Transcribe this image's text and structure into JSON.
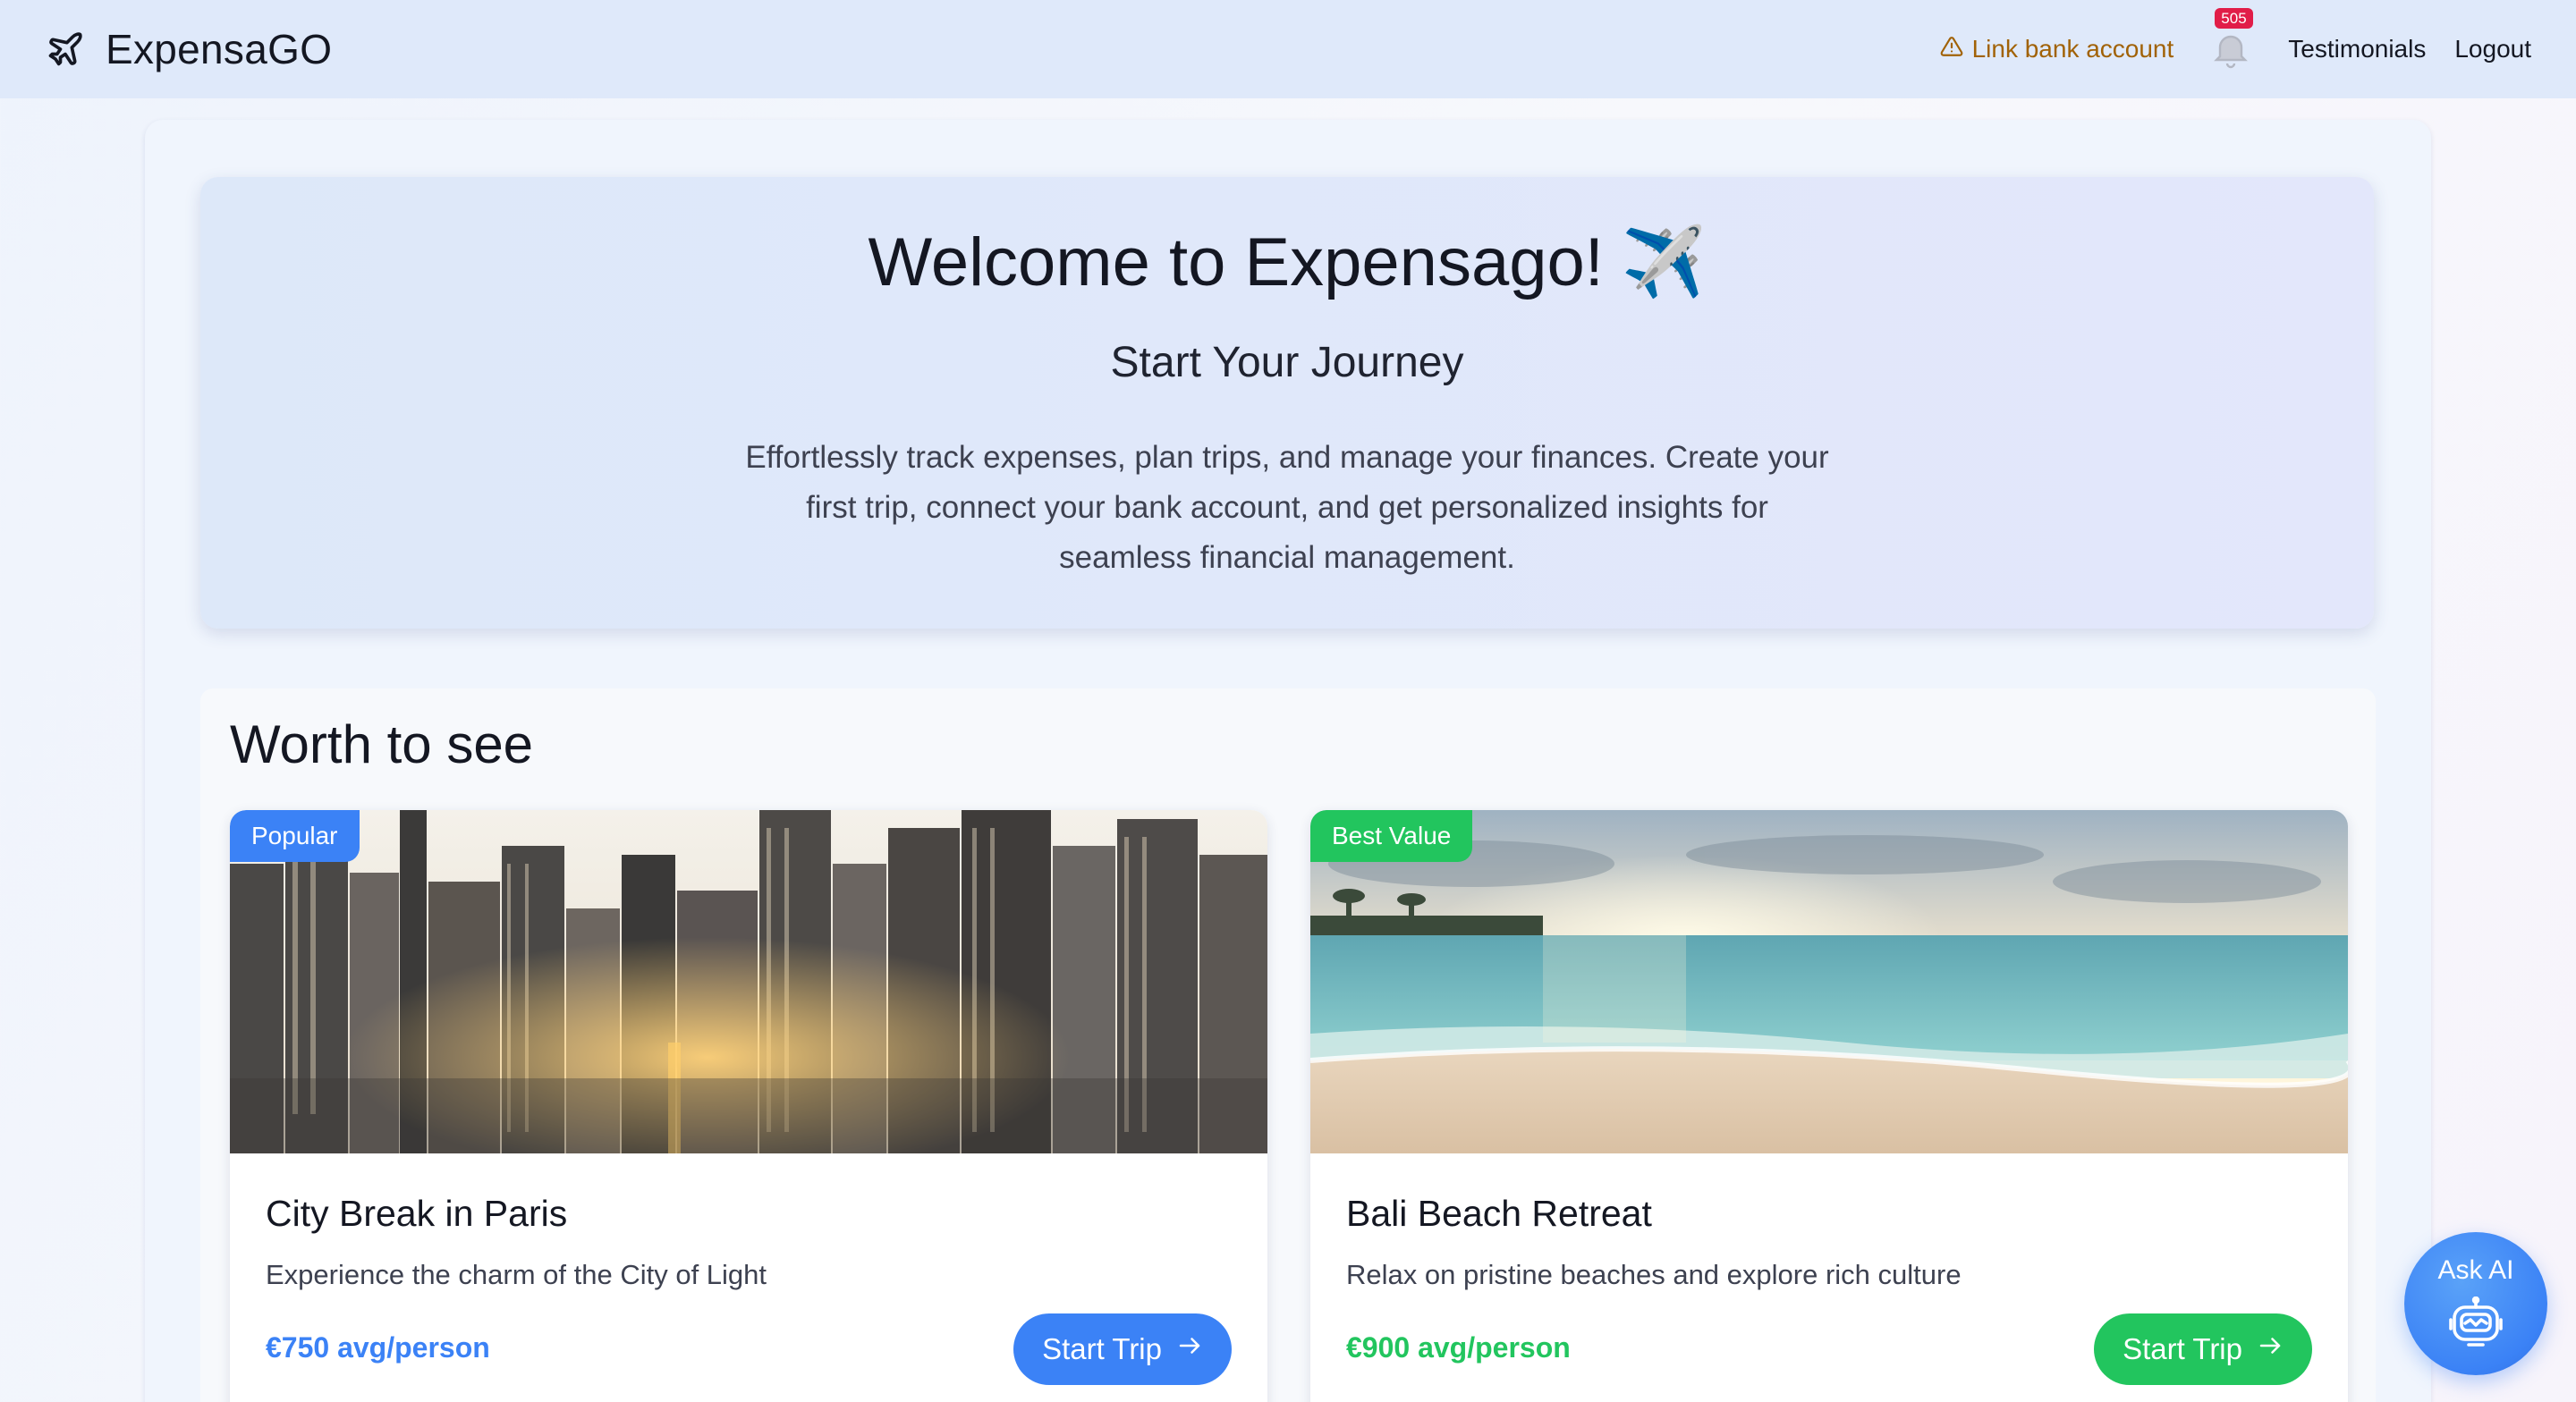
{
  "header": {
    "brand": "ExpensaGO",
    "brand_icon": "plane-icon",
    "link_bank": "Link bank account",
    "link_bank_icon": "warning-triangle-icon",
    "notification_badge": "505",
    "notification_icon": "bell-icon",
    "testimonials": "Testimonials",
    "logout": "Logout"
  },
  "hero": {
    "title": "Welcome to Expensago!",
    "title_emoji": "✈️",
    "subtitle": "Start Your Journey",
    "description": "Effortlessly track expenses, plan trips, and manage your finances. Create your first trip, connect your bank account, and get personalized insights for seamless financial management."
  },
  "worth": {
    "title": "Worth to see",
    "cards": [
      {
        "badge": "Popular",
        "title": "City Break in Paris",
        "description": "Experience the charm of the City of Light",
        "price": "€750 avg/person",
        "button": "Start Trip",
        "accent": "#3b82f6",
        "image": "city-skyline-photo"
      },
      {
        "badge": "Best Value",
        "title": "Bali Beach Retreat",
        "description": "Relax on pristine beaches and explore rich culture",
        "price": "€900 avg/person",
        "button": "Start Trip",
        "accent": "#22c55e",
        "image": "beach-sunset-photo"
      }
    ]
  },
  "ask_ai": {
    "label": "Ask AI",
    "icon": "robot-icon"
  },
  "colors": {
    "header_bg": "#dfe9fa",
    "primary": "#3b82f6",
    "success": "#22c55e",
    "warning": "#a16207",
    "badge": "#e11d48"
  }
}
